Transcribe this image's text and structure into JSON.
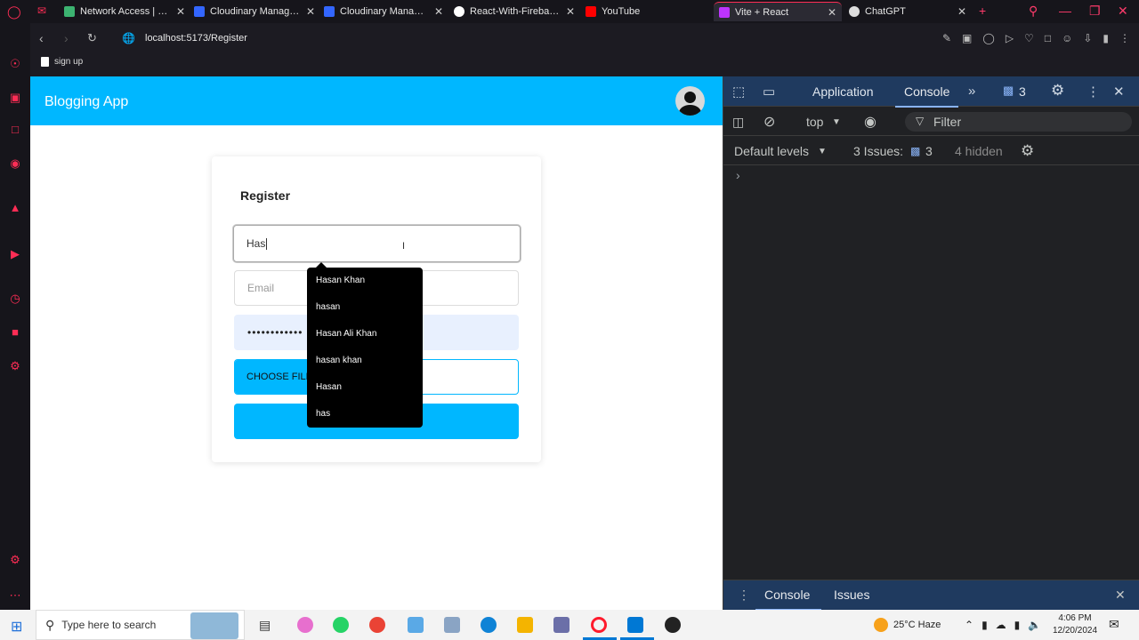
{
  "tabs": [
    {
      "label": "Network Access | Clou",
      "fav": "#3cb371"
    },
    {
      "label": "Cloudinary Manageme",
      "fav": "#3366ff"
    },
    {
      "label": "Cloudinary Manageme",
      "fav": "#3366ff"
    },
    {
      "label": "React-With-Firebase/s",
      "fav": "#ffffff"
    },
    {
      "label": "YouTube",
      "fav": "#ff0000"
    },
    {
      "label": "Vite + React",
      "fav": "#bd34fe"
    },
    {
      "label": "ChatGPT",
      "fav": "#dddddd"
    }
  ],
  "address": {
    "url": "localhost:5173/Register"
  },
  "bookmark": {
    "label": "sign up"
  },
  "app": {
    "title": "Blogging App"
  },
  "form": {
    "title": "Register",
    "name_value": "Has",
    "email_placeholder": "Email",
    "password_masked": "••••••••••••",
    "choose_file_label": "CHOOSE FILE"
  },
  "autocomplete": [
    "Hasan Khan",
    "hasan",
    "Hasan Ali Khan",
    "hasan khan",
    "Hasan",
    "has"
  ],
  "devtools": {
    "tab_application": "Application",
    "tab_console": "Console",
    "msg_count": "3",
    "context": "top",
    "filter_placeholder": "Filter",
    "levels": "Default levels",
    "issues_label": "3 Issues:",
    "issues_count": "3",
    "hidden": "4 hidden",
    "prompt": "›",
    "drawer_console": "Console",
    "drawer_issues": "Issues"
  },
  "taskbar": {
    "search_placeholder": "Type here to search",
    "weather": "25°C  Haze",
    "time": "4:06 PM",
    "date": "12/20/2024"
  },
  "colors": {
    "accent": "#00b7ff",
    "browser_accent": "#ff2d55"
  }
}
